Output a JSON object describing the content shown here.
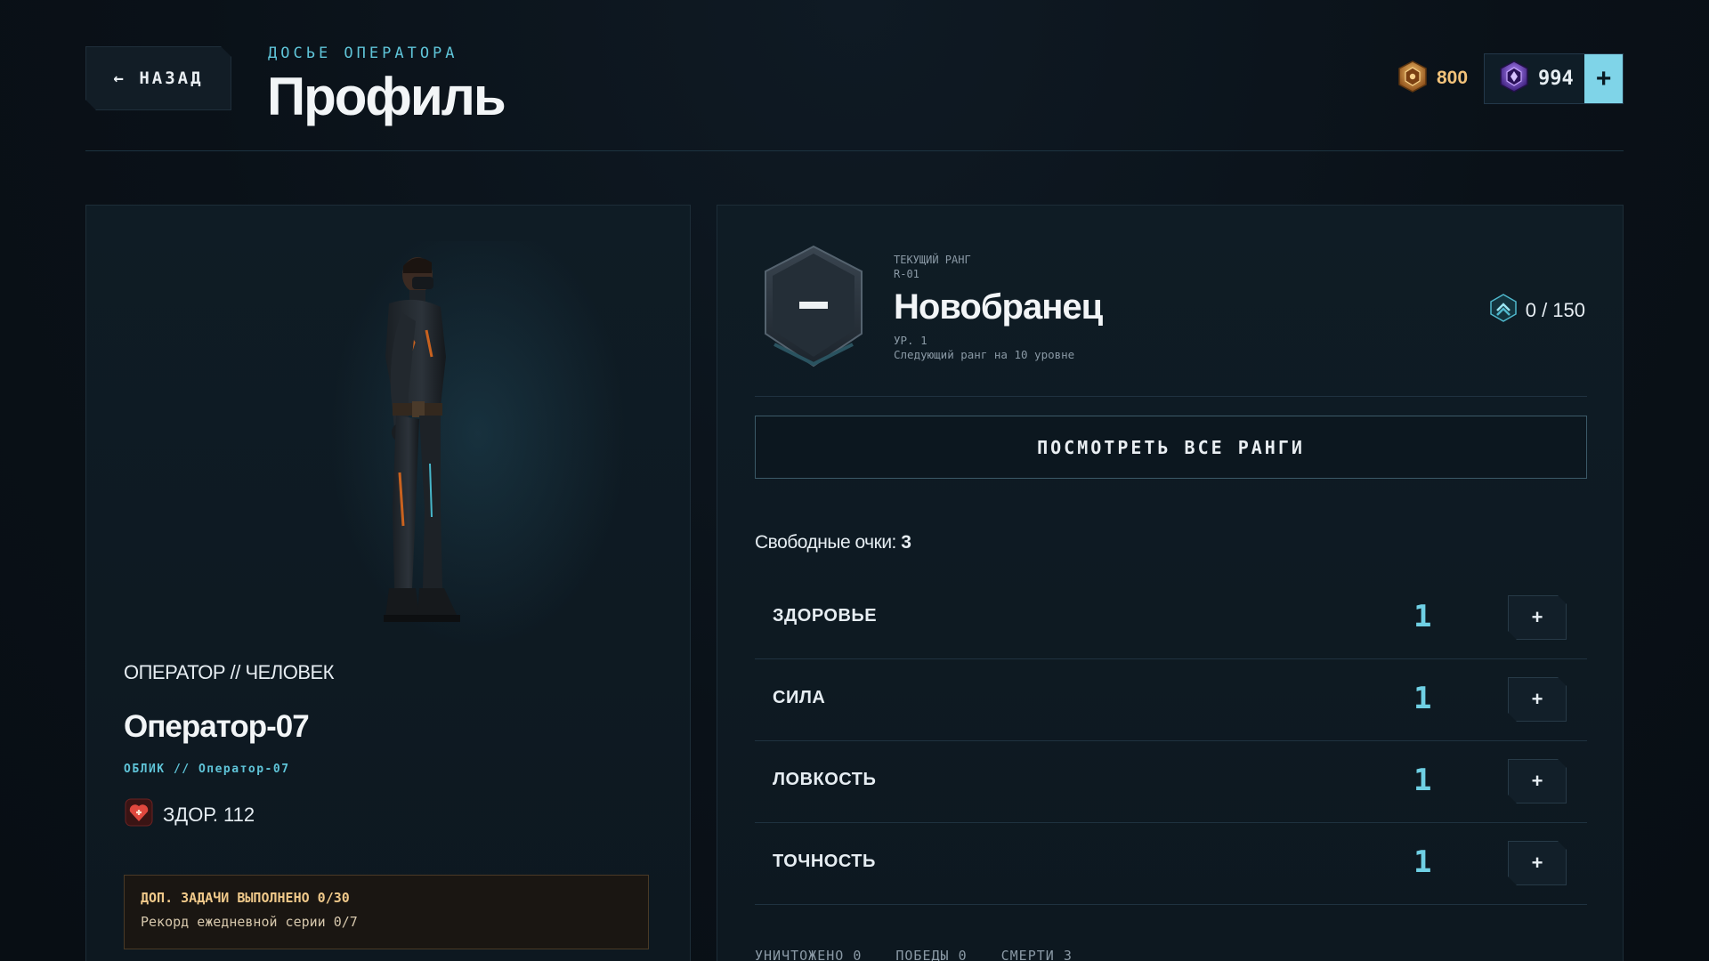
{
  "header": {
    "back_label": "← НАЗАД",
    "kicker": "ДОСЬЕ ОПЕРАТОРА",
    "title": "Профиль",
    "currency_gold": "800",
    "currency_gems": "994",
    "add_gems_label": "+"
  },
  "operator": {
    "type": "ОПЕРАТОР // ЧЕЛОВЕК",
    "name": "Оператор-07",
    "skin": "ОБЛИК // Оператор-07",
    "hp": "ЗДОР. 112",
    "quests_done": "ДОП. ЗАДАЧИ ВЫПОЛНЕНО 0/30",
    "daily_streak": "Рекорд ежедневной серии 0/7"
  },
  "rank": {
    "kicker": "ТЕКУЩИЙ РАНГ",
    "code": "R-01",
    "name": "Новобранец",
    "level": "УР. 1",
    "next": "Следующий ранг на 10 уровне",
    "xp": "0 / 150",
    "view_all_label": "ПОСМОТРЕТЬ ВСЕ РАНГИ"
  },
  "points": {
    "label": "Свободные очки: ",
    "value": "3"
  },
  "stats": [
    {
      "label": "ЗДОРОВЬЕ",
      "value": "1",
      "add": "+"
    },
    {
      "label": "СИЛА",
      "value": "1",
      "add": "+"
    },
    {
      "label": "ЛОВКОСТЬ",
      "value": "1",
      "add": "+"
    },
    {
      "label": "ТОЧНОСТЬ",
      "value": "1",
      "add": "+"
    }
  ],
  "tally": {
    "kills": "УНИЧТОЖЕНО 0",
    "wins": "ПОБЕДЫ 0",
    "deaths": "СМЕРТИ 3"
  },
  "icons": {
    "gold": "gold-coin-icon",
    "gem": "purple-gem-icon",
    "hp": "heart-icon",
    "xp": "rank-chevron-icon",
    "badge": "rank-badge-icon"
  },
  "colors": {
    "accent": "#6fd0e4",
    "gold": "#f2c27a",
    "gem": "#8a5cf0",
    "quest_text": "#f0c98a"
  }
}
